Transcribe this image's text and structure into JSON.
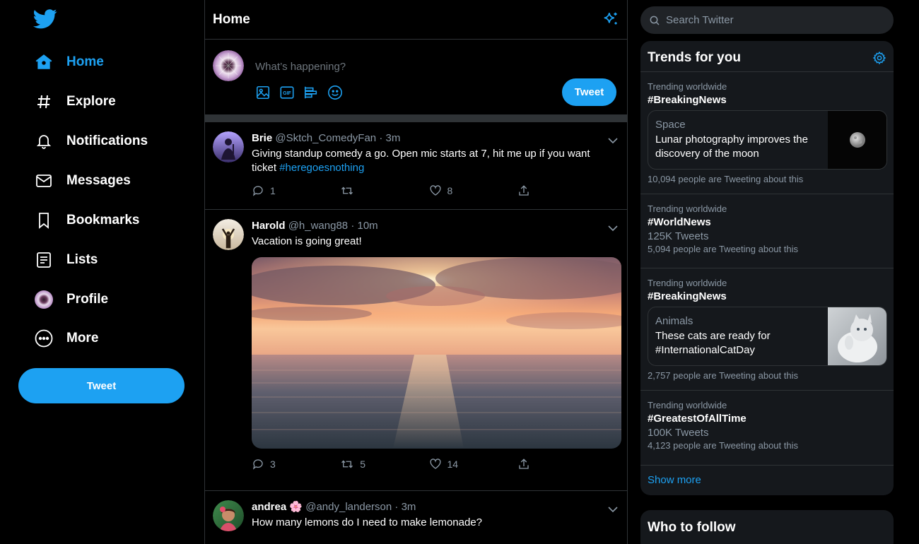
{
  "nav": {
    "items": [
      {
        "label": "Home",
        "icon": "home-icon",
        "active": true
      },
      {
        "label": "Explore",
        "icon": "hashtag-icon"
      },
      {
        "label": "Notifications",
        "icon": "bell-icon"
      },
      {
        "label": "Messages",
        "icon": "envelope-icon"
      },
      {
        "label": "Bookmarks",
        "icon": "bookmark-icon"
      },
      {
        "label": "Lists",
        "icon": "list-icon"
      },
      {
        "label": "Profile",
        "icon": "profile-avatar"
      },
      {
        "label": "More",
        "icon": "more-circle-icon"
      }
    ],
    "tweet_label": "Tweet"
  },
  "header": {
    "title": "Home"
  },
  "composer": {
    "placeholder": "What’s happening?",
    "tweet_label": "Tweet",
    "gif_label": "GIF"
  },
  "tweets": [
    {
      "name": "Brie",
      "handle": "@Sktch_ComedyFan",
      "time": "3m",
      "text": "Giving standup comedy a go. Open mic starts at 7, hit me up if you want ticket ",
      "hashtag": "#heregoesnothing",
      "replies": "1",
      "retweets": "",
      "likes": "8"
    },
    {
      "name": "Harold",
      "handle": "@h_wang88",
      "time": "10m",
      "text": "Vacation is going great!",
      "replies": "3",
      "retweets": "5",
      "likes": "14"
    },
    {
      "name": "andrea",
      "emoji": "🌸",
      "handle": "@andy_landerson",
      "time": "3m",
      "text": "How many lemons do I need to make lemonade?"
    }
  ],
  "search": {
    "placeholder": "Search Twitter"
  },
  "trends": {
    "title": "Trends for you",
    "items": [
      {
        "context": "Trending worldwide",
        "tag": "#BreakingNews",
        "card": {
          "category": "Space",
          "headline": "Lunar photography improves the discovery of the moon"
        },
        "people": "10,094 people are Tweeting about this"
      },
      {
        "context": "Trending worldwide",
        "tag": "#WorldNews",
        "count": "125K Tweets",
        "people": "5,094 people are Tweeting about this"
      },
      {
        "context": "Trending worldwide",
        "tag": "#BreakingNews",
        "card": {
          "category": "Animals",
          "headline": "These cats are ready for #InternationalCatDay"
        },
        "people": "2,757 people are Tweeting about this"
      },
      {
        "context": "Trending worldwide",
        "tag": "#GreatestOfAllTime",
        "count": "100K Tweets",
        "people": "4,123 people are Tweeting about this"
      }
    ],
    "show_more": "Show more"
  },
  "who_to_follow": {
    "title": "Who to follow"
  },
  "colors": {
    "accent": "#1da1f2",
    "background": "#000000",
    "panel": "#15181c",
    "border": "#2f3336",
    "muted": "#8b98a5"
  }
}
